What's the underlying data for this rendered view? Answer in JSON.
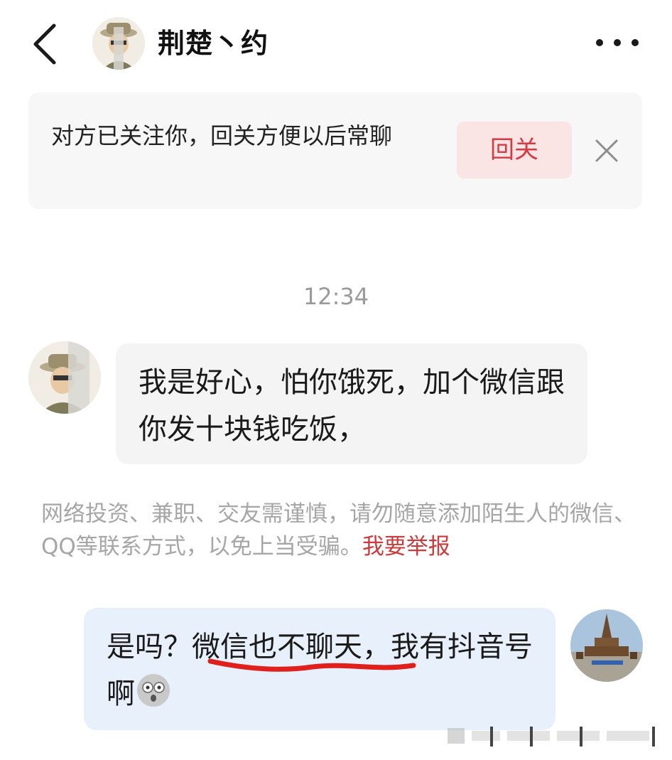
{
  "header": {
    "contact_name": "荆楚丶约"
  },
  "follow_banner": {
    "message": "对方已关注你，回关方便以后常聊",
    "button_label": "回关"
  },
  "chat": {
    "timestamp": "12:34",
    "received_message": "我是好心，怕你饿死，加个微信跟你发十块钱吃饭，",
    "warning_text": "网络投资、兼职、交友需谨慎，请勿随意添加陌生人的微信、QQ等联系方式，以免上当受骗。",
    "report_link": "我要举报",
    "sent_message": "是吗？微信也不聊天，我有抖音号啊",
    "sent_emoji": "wide-eyed-face-icon"
  },
  "colors": {
    "accent_red": "#d83a44",
    "report_red": "#cc3b3b",
    "sent_bubble": "#e7f0fb",
    "received_bubble": "#f4f4f5",
    "banner_bg": "#f7f7f8",
    "underline_mark": "#e0201c"
  }
}
